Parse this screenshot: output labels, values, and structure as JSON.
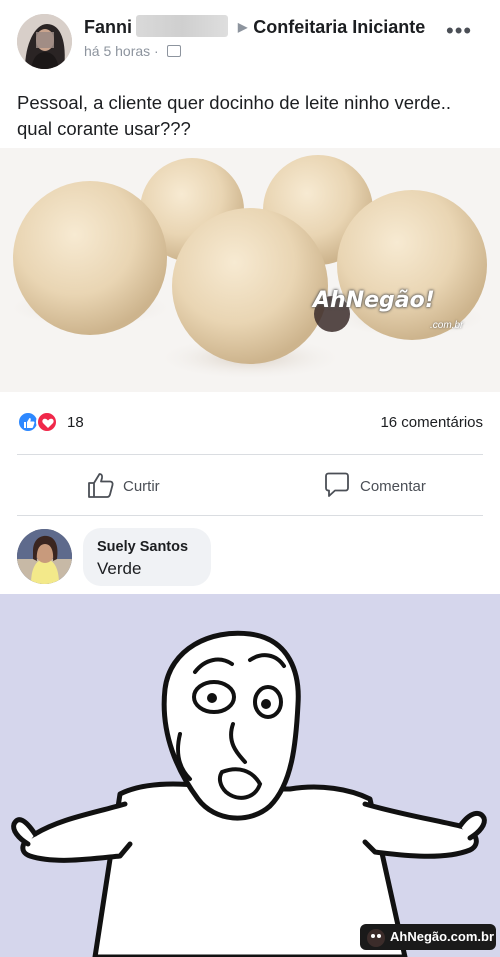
{
  "post": {
    "author": "Fanni",
    "group": "Confeitaria Iniciante",
    "time": "há 5 horas",
    "more_icon": "more-horizontal-icon",
    "text": "Pessoal, a cliente quer docinho de leite ninho verde.. qual corante usar???"
  },
  "photo": {
    "watermark": "AhNegão!",
    "watermark_sub": ".com.br"
  },
  "reactions": {
    "count": "18",
    "comments": "16 comentários",
    "like_color": "#2d88ff",
    "love_color": "#f0284a"
  },
  "actions": {
    "like_label": "Curtir",
    "comment_label": "Comentar"
  },
  "comment": {
    "name": "Suely Santos",
    "text": "Verde"
  },
  "meme": {
    "logo_text": "AhNegão.com.br",
    "background": "#d5d6ec"
  }
}
